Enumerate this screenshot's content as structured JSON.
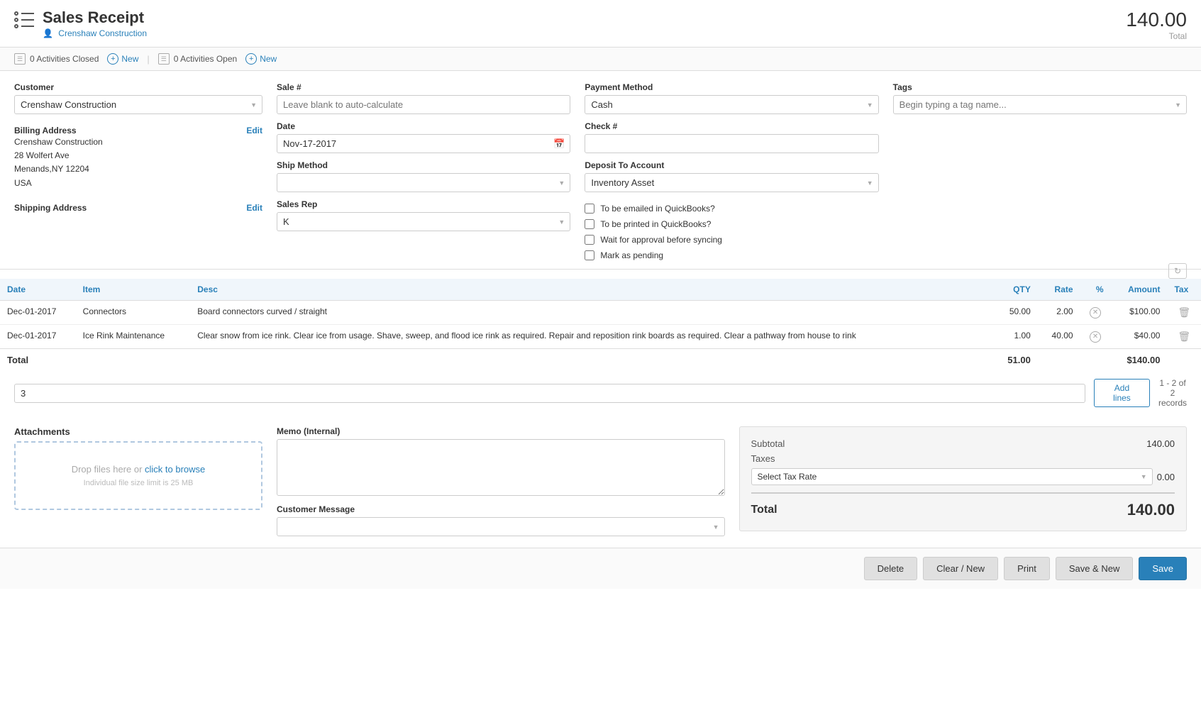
{
  "header": {
    "title": "Sales Receipt",
    "breadcrumb_text": "Crenshaw  Construction",
    "total_amount": "140.00",
    "total_label": "Total"
  },
  "activity_bar": {
    "closed_count": "0 Activities Closed",
    "new1_label": "New",
    "open_count": "0 Activities Open",
    "new2_label": "New"
  },
  "form": {
    "customer_label": "Customer",
    "customer_value": "Crenshaw Construction",
    "billing_address_label": "Billing Address",
    "billing_edit_label": "Edit",
    "billing_addr1": "Crenshaw Construction",
    "billing_addr2": "28 Wolfert Ave",
    "billing_addr3": "Menands,NY 12204",
    "billing_addr4": "USA",
    "shipping_address_label": "Shipping Address",
    "shipping_edit_label": "Edit",
    "sale_label": "Sale #",
    "sale_placeholder": "Leave blank to auto-calculate",
    "date_label": "Date",
    "date_value": "Nov-17-2017",
    "ship_method_label": "Ship Method",
    "ship_method_value": "",
    "sales_rep_label": "Sales Rep",
    "sales_rep_value": "K",
    "payment_method_label": "Payment Method",
    "payment_method_value": "Cash",
    "check_num_label": "Check #",
    "check_value": "",
    "deposit_label": "Deposit To Account",
    "deposit_value": "Inventory Asset",
    "tags_label": "Tags",
    "tags_placeholder": "Begin typing a tag name...",
    "cb_email": "To be emailed in QuickBooks?",
    "cb_print": "To be printed in QuickBooks?",
    "cb_approval": "Wait for approval before syncing",
    "cb_pending": "Mark as pending"
  },
  "table": {
    "headers": [
      "Date",
      "Item",
      "Desc",
      "QTY",
      "Rate",
      "%",
      "Amount",
      "Tax"
    ],
    "rows": [
      {
        "date": "Dec-01-2017",
        "item": "Connectors",
        "desc": "Board connectors curved / straight",
        "qty": "50.00",
        "rate": "2.00",
        "amount": "$100.00"
      },
      {
        "date": "Dec-01-2017",
        "item": "Ice Rink Maintenance",
        "desc": "Clear snow from ice rink. Clear ice from usage. Shave, sweep, and flood ice rink as required. Repair and reposition rink boards as required. Clear a pathway from house to rink",
        "qty": "1.00",
        "rate": "40.00",
        "amount": "$40.00"
      }
    ],
    "total_label": "Total",
    "total_qty": "51.00",
    "total_amount": "$140.00"
  },
  "add_lines": {
    "lines_value": "3",
    "add_button_label": "Add lines",
    "records_info": "1 - 2 of 2 records"
  },
  "bottom": {
    "attachments_label": "Attachments",
    "drop_text": "Drop files here or ",
    "drop_link": "click to browse",
    "size_limit": "Individual file size limit is 25 MB",
    "memo_label": "Memo (Internal)",
    "customer_message_label": "Customer Message",
    "subtotal_label": "Subtotal",
    "subtotal_value": "140.00",
    "taxes_label": "Taxes",
    "tax_rate_placeholder": "Select Tax Rate",
    "tax_value": "0.00",
    "total_label": "Total",
    "total_value": "140.00"
  },
  "footer": {
    "delete_label": "Delete",
    "clear_new_label": "Clear / New",
    "print_label": "Print",
    "save_new_label": "Save & New",
    "save_label": "Save"
  }
}
